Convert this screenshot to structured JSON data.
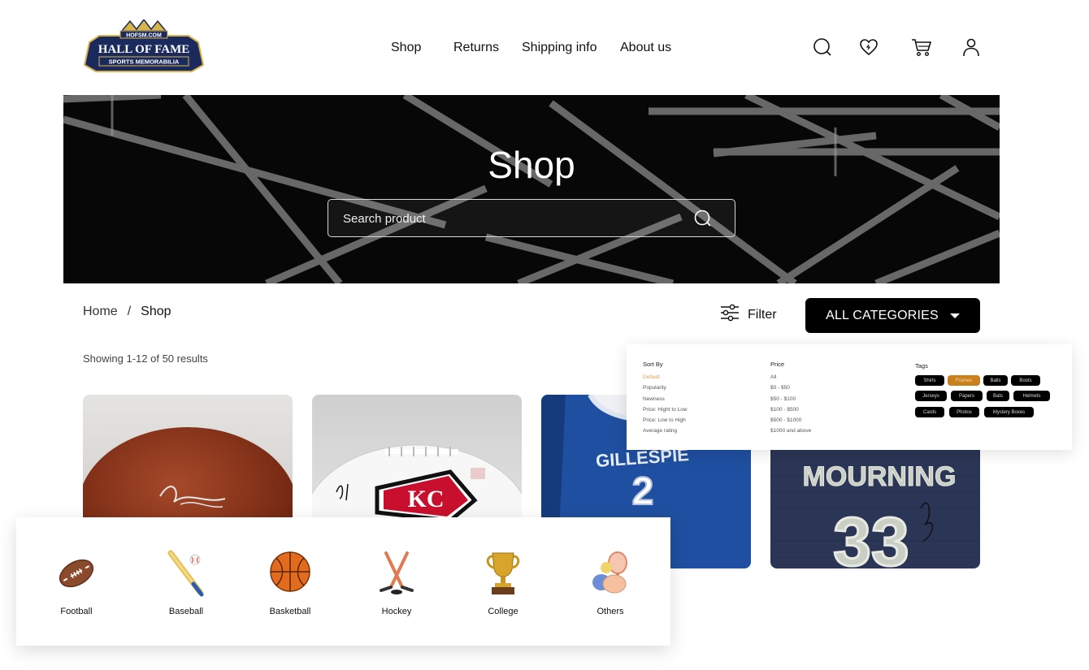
{
  "header": {
    "logo": {
      "line1": "HOFSM.COM",
      "line2": "HALL OF FAME",
      "line3": "SPORTS MEMORABILIA"
    },
    "nav": [
      "Shop",
      "Returns",
      "Shipping info",
      "About us"
    ],
    "icons": [
      "search-icon",
      "wishlist-heart-icon",
      "cart-icon",
      "account-icon"
    ]
  },
  "hero": {
    "title": "Shop",
    "search_placeholder": "Search product"
  },
  "breadcrumb": {
    "home": "Home",
    "separator": "/",
    "current": "Shop"
  },
  "controls": {
    "filter_label": "Filter",
    "categories_label": "ALL CATEGORIES"
  },
  "results_text": "Showing 1-12 of 50 results",
  "filter_panel": {
    "sort_by": {
      "heading": "Sort By",
      "options": [
        "Default",
        "Popularity",
        "Newness",
        "Price: Hight to Low",
        "Price: Low to High",
        "Average rating"
      ],
      "selected": "Default"
    },
    "price": {
      "heading": "Price",
      "options": [
        "All",
        "$0 - $50",
        "$50 - $100",
        "$100 - $500",
        "$500 - $1000",
        "$1000 and above"
      ]
    },
    "tags": {
      "heading": "Tags",
      "items": [
        "Shirts",
        "Frames",
        "Balls",
        "Boots",
        "Jerseys",
        "Papers",
        "Bats",
        "Helmets",
        "Cards",
        "Photos",
        "Mystery Boxes"
      ],
      "selected": "Frames"
    }
  },
  "products": [
    {
      "name": "signed-football"
    },
    {
      "name": "signed-chiefs-football"
    },
    {
      "name": "gillespie-jersey",
      "text": "GILLESPIE",
      "number": "2"
    },
    {
      "name": "mourning-jersey",
      "text": "MOURNING",
      "number": "33"
    }
  ],
  "categories": [
    "Football",
    "Baseball",
    "Basketball",
    "Hockey",
    "College",
    "Others"
  ],
  "colors": {
    "accent": "#c8811c",
    "dark": "#000000",
    "logo_navy": "#1b2a5c",
    "logo_gold": "#d9b44a"
  }
}
